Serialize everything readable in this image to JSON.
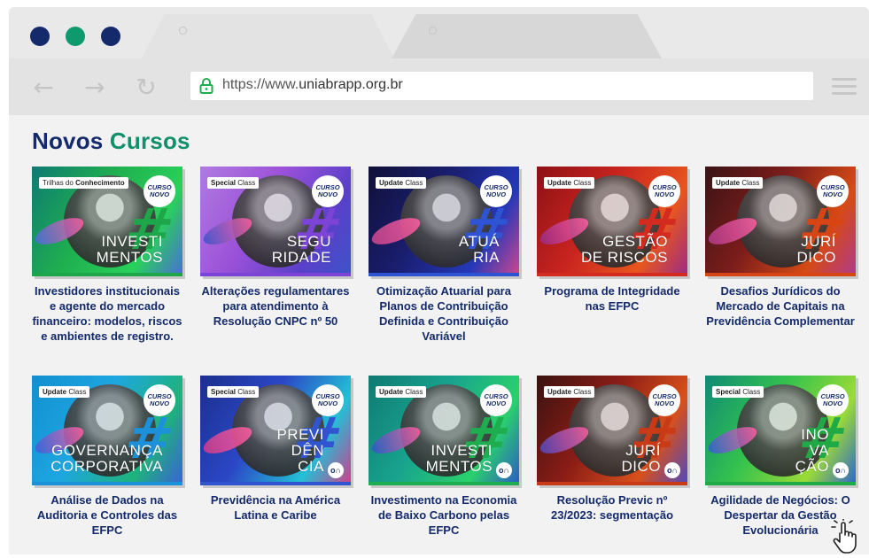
{
  "browser": {
    "controls": [
      "close",
      "minimize",
      "maximize"
    ],
    "url_prefix": "https://www.",
    "url_domain": "uniabrapp",
    "url_suffix": ".org.br",
    "nav": {
      "back_icon": "←",
      "forward_icon": "→",
      "reload_icon": "↻"
    }
  },
  "section": {
    "title_main": "Novos",
    "title_accent": "Cursos"
  },
  "courses": [
    {
      "badge_type": "Trilhas do",
      "badge_bold": "Conhecimento",
      "overlay": "INVESTI\nMENTOS",
      "novo": "CURSO NOVO",
      "title": "Investidores institucionais e agente do mercado financeiro: modelos, riscos e ambientes de registro.",
      "has_logo": false
    },
    {
      "badge_type": "Special",
      "badge_bold": "Class",
      "overlay": "SEGU\nRIDADE",
      "novo": "CURSO NOVO",
      "title": "Alterações regulamentares para atendimento à Resolução CNPC nº 50",
      "has_logo": false
    },
    {
      "badge_type": "Update",
      "badge_bold": "Class",
      "overlay": "ATUÁ\nRIA",
      "novo": "CURSO NOVO",
      "title": "Otimização Atuarial para Planos de Contribuição Definida e Contribuição Variável",
      "has_logo": false
    },
    {
      "badge_type": "Update",
      "badge_bold": "Class",
      "overlay": "GESTÃO\nDE RISCOS",
      "novo": "CURSO NOVO",
      "title": "Programa de Integridade nas EFPC",
      "has_logo": false
    },
    {
      "badge_type": "Update",
      "badge_bold": "Class",
      "overlay": "JURÍ\nDICO",
      "novo": "CURSO NOVO",
      "title": "Desafios Jurídicos do Mercado de Capitais na Previdência Complementar",
      "has_logo": false
    },
    {
      "badge_type": "Update",
      "badge_bold": "Class",
      "overlay": "GOVERNANÇA\nCORPORATIVA",
      "novo": "CURSO NOVO",
      "title": "Análise de Dados na Auditoria e Controles das EFPC",
      "has_logo": false
    },
    {
      "badge_type": "Special",
      "badge_bold": "Class",
      "overlay": "PREVI\nDÊN\nCIA",
      "novo": "CURSO NOVO",
      "title": "Previdência na América Latina e Caribe",
      "has_logo": true
    },
    {
      "badge_type": "Update",
      "badge_bold": "Class",
      "overlay": "INVESTI\nMENTOS",
      "novo": "CURSO NOVO",
      "title": "Investimento na Economia de Baixo Carbono pelas EFPC",
      "has_logo": true
    },
    {
      "badge_type": "Update",
      "badge_bold": "Class",
      "overlay": "JURÍ\nDICO",
      "novo": "CURSO NOVO",
      "title": "Resolução Previc nº 23/2023: segmentação",
      "has_logo": true
    },
    {
      "badge_type": "Special",
      "badge_bold": "Class",
      "overlay": "INO\nVA\nÇÃO",
      "novo": "CURSO NOVO",
      "title": "Agilidade de Negócios: O Despertar da Gestão Evolucionária",
      "has_logo": true
    }
  ],
  "logo_mark": "o∩",
  "colors": {
    "navy": "#142a6b",
    "green": "#0f8f6a",
    "thumb_themes": [
      [
        "#0f7a73",
        "#1fae4f",
        "#29d15a",
        "#4a6cd8",
        "#1ea64a"
      ],
      [
        "#b07be0",
        "#9b51d8",
        "#5a40c9",
        "#3d53c8",
        "#7b43d6"
      ],
      [
        "#101038",
        "#1a1e6e",
        "#2438b8",
        "#d0478f",
        "#2e54d4"
      ],
      [
        "#8c1116",
        "#c9241f",
        "#e8561e",
        "#9b2b86",
        "#d42b20"
      ],
      [
        "#3a1316",
        "#7c1d1b",
        "#d64a15",
        "#b13a8c",
        "#d84515"
      ],
      [
        "#128fd0",
        "#1ea6e0",
        "#1eb37b",
        "#3c60d8",
        "#1c90d8"
      ],
      [
        "#1b2f8c",
        "#2b47c6",
        "#23c0d6",
        "#d13c8a",
        "#3155d0"
      ],
      [
        "#0f7a73",
        "#18a38e",
        "#2ad16c",
        "#2d58c8",
        "#1fae4f"
      ],
      [
        "#3b1210",
        "#8b1d16",
        "#d8501a",
        "#4f49c0",
        "#c93a16"
      ],
      [
        "#0f8a76",
        "#34c24e",
        "#9adb36",
        "#2f62cf",
        "#1faa45"
      ]
    ]
  }
}
